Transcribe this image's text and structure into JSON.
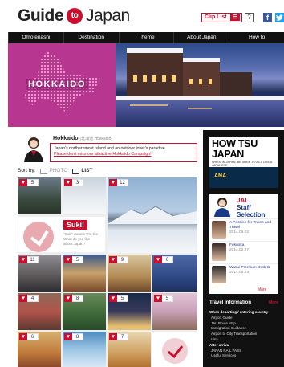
{
  "header": {
    "logo_left": "Guide",
    "logo_to": "to",
    "logo_right": "Japan",
    "clip_list": "Clip List",
    "help": "?",
    "facebook": "f"
  },
  "nav": [
    "Omotenashi",
    "Destination",
    "Theme",
    "About Japan",
    "How to"
  ],
  "hero": {
    "title": "HOKKAIDO"
  },
  "destination": {
    "name": "Hokkaido",
    "name_jp": "(北海道 Hokkaido)",
    "desc": "Japan's northernmost island and an outdoor lover's paradise",
    "link": "Please don't miss our attractive Hokkaido Campaign!"
  },
  "sort": {
    "label": "Sort by:",
    "photo": "PHOTO",
    "list": "LIST"
  },
  "tiles": {
    "t1": "5",
    "t2": "3",
    "t3": "12",
    "suki_title": "Suki!",
    "suki_sub1": "\"Suki\" means \"I'm like",
    "suki_sub2": "What do you like",
    "suki_sub3": "about Japan?",
    "t5": "11",
    "t6": "5",
    "t7": "9",
    "t8": "6",
    "t9": "4",
    "t10": "8",
    "t11": "5",
    "t12": "5",
    "t13": "6",
    "t14": "8",
    "t15": "7"
  },
  "sidebar": {
    "ad_title_1": "HOW TSU",
    "ad_title_2": "JAPAN",
    "ad_sub": "WHEN IN JAPAN, BE SURE TO ACT LIKE A JAPANESE",
    "ad_banner": "ANA",
    "staff_title_1": "JAL",
    "staff_title_2": "Staff",
    "staff_title_3": "Selection",
    "staff": [
      {
        "title": "A Passion for Trains and Travel",
        "date": "2014.06.02"
      },
      {
        "title": "Fukuoka",
        "date": "2014.02.27"
      },
      {
        "title": "Wasui Premium Outlets",
        "date": "2014.06.23"
      }
    ],
    "more": "More",
    "travel_info": "Travel Information",
    "travel_more": "More",
    "ti_sec1": "When departing / entering country",
    "ti_items1": [
      "Airport Guide",
      "JAL Route Map",
      "Immigration Guidance",
      "Airport to City Transportation",
      "Visa"
    ],
    "ti_sec2": "After arrival",
    "ti_items2": [
      "JAPAN RAIL PASS",
      "Useful Services"
    ]
  }
}
